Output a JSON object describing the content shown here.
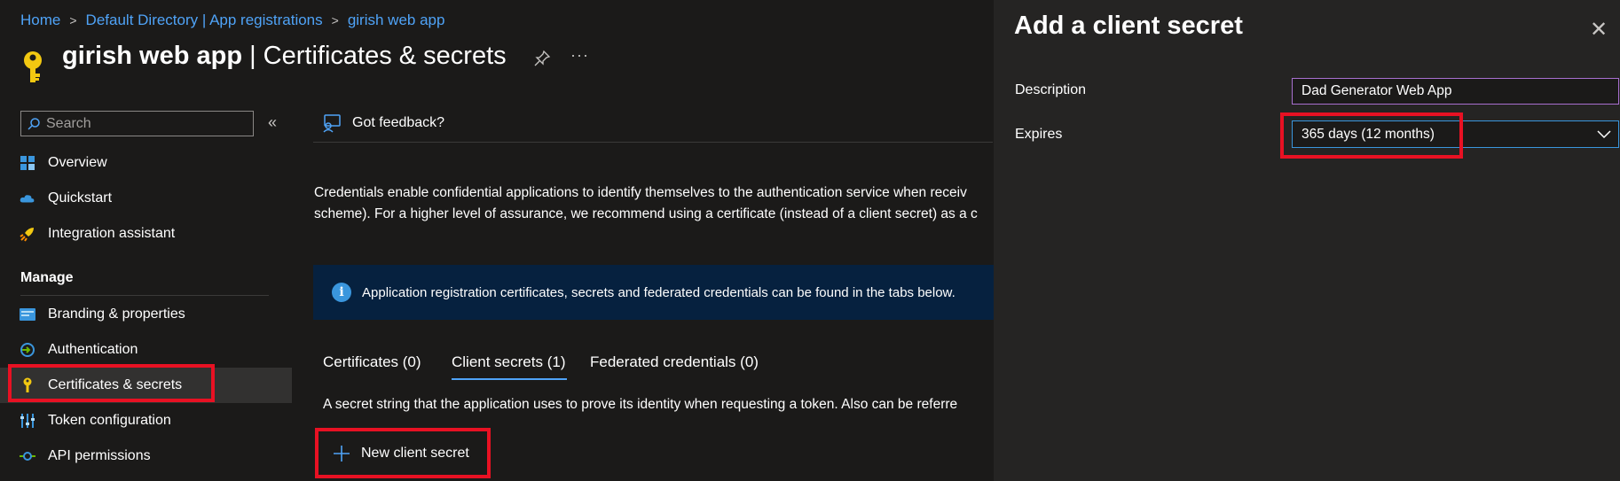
{
  "breadcrumb": {
    "items": [
      "Home",
      "Default Directory | App registrations",
      "girish web app"
    ],
    "separator": ">"
  },
  "header": {
    "app_name": "girish web app",
    "page_name": " | Certificates & secrets",
    "more_label": "···"
  },
  "search": {
    "placeholder": "Search",
    "collapse_label": "«"
  },
  "sidebar": {
    "items": [
      {
        "label": "Overview",
        "icon": "grid-icon"
      },
      {
        "label": "Quickstart",
        "icon": "cloud-icon"
      },
      {
        "label": "Integration assistant",
        "icon": "rocket-icon"
      }
    ],
    "section": "Manage",
    "manage_items": [
      {
        "label": "Branding & properties",
        "icon": "card-icon"
      },
      {
        "label": "Authentication",
        "icon": "auth-icon"
      },
      {
        "label": "Certificates & secrets",
        "icon": "key-icon",
        "selected": true
      },
      {
        "label": "Token configuration",
        "icon": "sliders-icon"
      },
      {
        "label": "API permissions",
        "icon": "api-icon"
      }
    ]
  },
  "main": {
    "feedback_label": "Got feedback?",
    "description_line1": "Credentials enable confidential applications to identify themselves to the authentication service when receiv",
    "description_line2": "scheme). For a higher level of assurance, we recommend using a certificate (instead of a client secret) as a c",
    "info_text": "Application registration certificates, secrets and federated credentials can be found in the tabs below.",
    "tabs": [
      "Certificates (0)",
      "Client secrets (1)",
      "Federated credentials (0)"
    ],
    "active_tab": "Client secrets (1)",
    "secret_description": "A secret string that the application uses to prove its identity when requesting a token. Also can be referre",
    "new_secret_label": "New client secret"
  },
  "panel": {
    "title": "Add a client secret",
    "close_label": "✕",
    "description_label": "Description",
    "description_value": "Dad Generator Web App",
    "expires_label": "Expires",
    "expires_value": "365 days (12 months)"
  },
  "colors": {
    "link": "#4fa3f7",
    "highlight": "#e81123",
    "info_bg": "#06213f",
    "accent": "#3a96dd"
  }
}
